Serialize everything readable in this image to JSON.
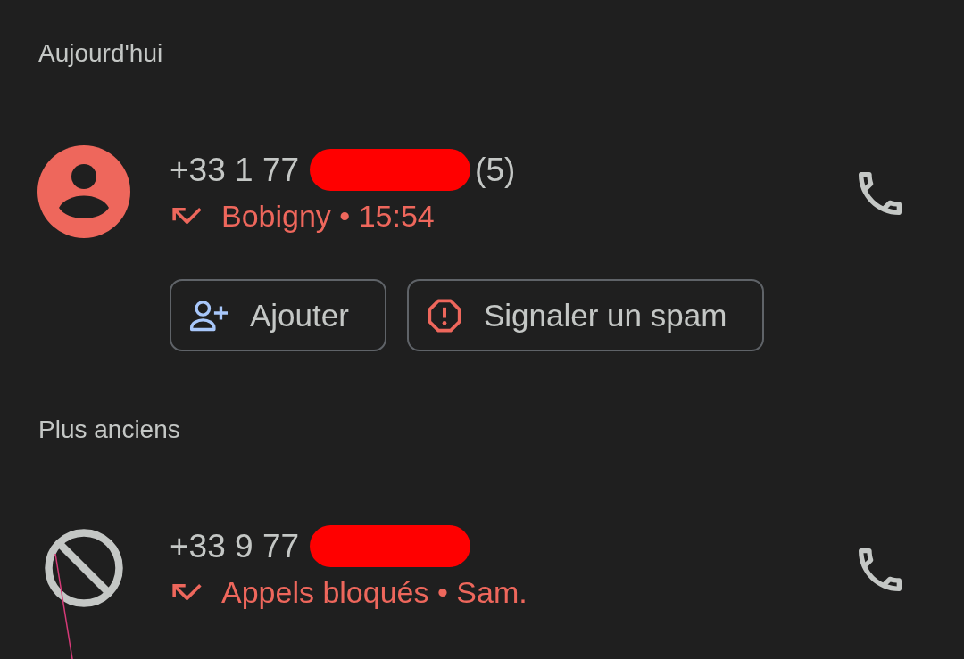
{
  "sections": [
    {
      "title": "Aujourd'hui",
      "calls": [
        {
          "kind": "contact",
          "number": "+33 1 77",
          "redacted": true,
          "count": "(5)",
          "missed": true,
          "detail": "Bobigny • 15:54",
          "actions": [
            {
              "kind": "add",
              "label": "Ajouter"
            },
            {
              "kind": "spam",
              "label": "Signaler un spam"
            }
          ]
        }
      ]
    },
    {
      "title": "Plus anciens",
      "calls": [
        {
          "kind": "blocked",
          "number": "+33 9 77",
          "redacted": true,
          "missed": true,
          "detail": "Appels bloqués • Sam."
        }
      ]
    }
  ]
}
